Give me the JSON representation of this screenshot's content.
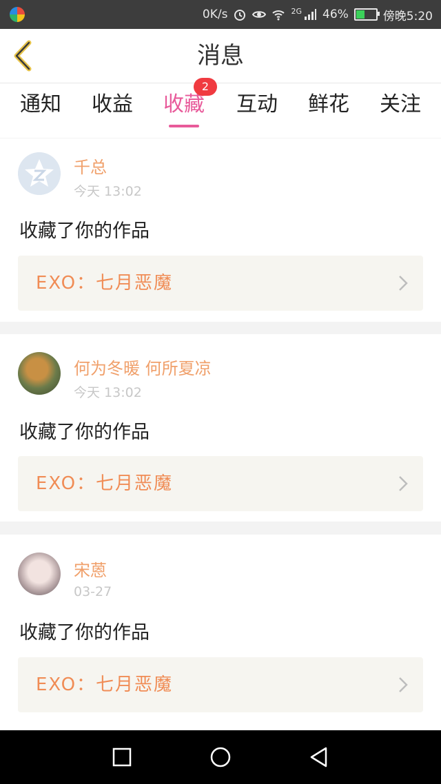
{
  "status_bar": {
    "speed": "0K/s",
    "signal_label": "2G",
    "battery_percent": "46%",
    "battery_level": 0.46,
    "time": "傍晚5:20"
  },
  "header": {
    "title": "消息"
  },
  "tabs": [
    {
      "label": "通知"
    },
    {
      "label": "收益"
    },
    {
      "label": "收藏",
      "badge": "2",
      "active": true
    },
    {
      "label": "互动"
    },
    {
      "label": "鲜花"
    },
    {
      "label": "关注"
    }
  ],
  "items": [
    {
      "user": "千总",
      "time": "今天 13:02",
      "action": "收藏了你的作品",
      "work_title": "EXO：七月恶魔"
    },
    {
      "user": "何为冬暖 何所夏凉",
      "time": "今天 13:02",
      "action": "收藏了你的作品",
      "work_title": "EXO：七月恶魔"
    },
    {
      "user": "宋蒽",
      "time": "03-27",
      "action": "收藏了你的作品",
      "work_title": "EXO：七月恶魔"
    }
  ],
  "colors": {
    "accent": "#e85a9a",
    "username": "#f0a06b",
    "work_title": "#f08c55",
    "badge": "#f03a40"
  }
}
